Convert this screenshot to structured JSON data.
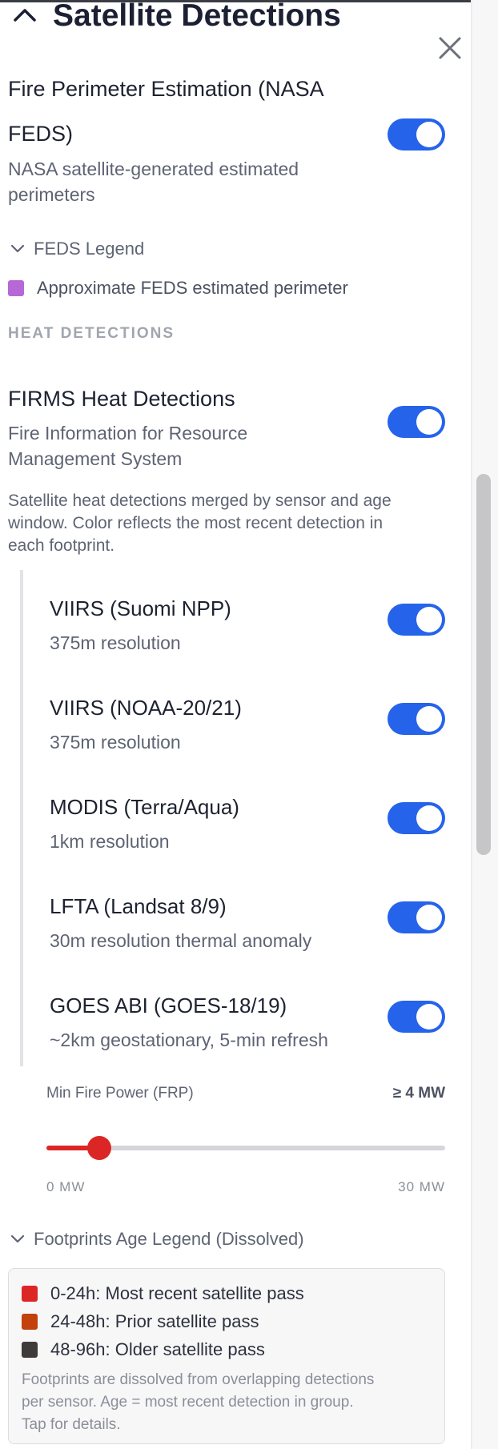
{
  "header": {
    "title": "Satellite Detections"
  },
  "feds": {
    "title_line1": "Fire Perimeter Estimation (NASA",
    "title_line2": "FEDS)",
    "subtitle_line1": "NASA satellite-generated estimated",
    "subtitle_line2": "perimeters",
    "enabled": true,
    "legend_label": "FEDS Legend",
    "legend_item": "Approximate FEDS estimated perimeter",
    "legend_color": "#b768d6"
  },
  "heat": {
    "group_heading": "HEAT DETECTIONS",
    "title": "FIRMS Heat Detections",
    "subtitle_line1": "Fire Information for Resource",
    "subtitle_line2": "Management System",
    "enabled": true,
    "description_line1": "Satellite heat detections merged by sensor and age",
    "description_line2": "window. Color reflects the most recent detection in",
    "description_line3": "each footprint."
  },
  "sensors": [
    {
      "title": "VIIRS (Suomi NPP)",
      "subtitle": "375m resolution",
      "enabled": true
    },
    {
      "title": "VIIRS (NOAA-20/21)",
      "subtitle": "375m resolution",
      "enabled": true
    },
    {
      "title": "MODIS (Terra/Aqua)",
      "subtitle": "1km resolution",
      "enabled": true
    },
    {
      "title": "LFTA (Landsat 8/9)",
      "subtitle": "30m resolution thermal anomaly",
      "enabled": true
    },
    {
      "title": "GOES ABI (GOES-18/19)",
      "subtitle": "~2km geostationary, 5-min refresh",
      "enabled": true
    }
  ],
  "frp": {
    "label": "Min Fire Power (FRP)",
    "value_label": "≥ 4 MW",
    "value": 4,
    "min": 0,
    "max": 30,
    "min_label": "0 MW",
    "max_label": "30 MW"
  },
  "age_legend": {
    "label": "Footprints Age Legend (Dissolved)",
    "items": [
      {
        "label": "0-24h: Most recent satellite pass",
        "color": "#dc2626"
      },
      {
        "label": "24-48h: Prior satellite pass",
        "color": "#c2410c"
      },
      {
        "label": "48-96h: Older satellite pass",
        "color": "#3f3b3a"
      }
    ],
    "note_line1": "Footprints are dissolved from overlapping detections",
    "note_line2": "per sensor. Age = most recent detection in group.",
    "note_line3": "Tap for details."
  },
  "colors": {
    "accent": "#2563eb",
    "slider": "#dc2626"
  }
}
